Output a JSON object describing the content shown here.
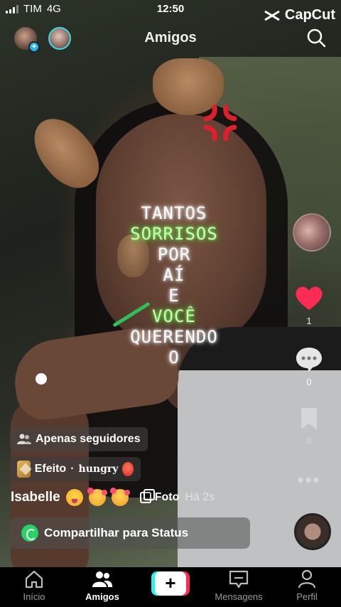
{
  "status_bar": {
    "carrier": "TIM",
    "network": "4G",
    "time": "12:50",
    "watermark": "CapCut"
  },
  "header": {
    "title": "Amigos"
  },
  "overlay": {
    "lines": [
      "TANTOS",
      "SORRISOS",
      "POR",
      "AÍ",
      "E",
      "VOCÊ",
      "QUERENDO",
      "O"
    ]
  },
  "rail": {
    "likes": "1",
    "comments": "0",
    "saves": "0"
  },
  "post": {
    "audience": "Apenas seguidores",
    "effect_label": "Efeito",
    "effect_separator": "·",
    "effect_name": "hungry",
    "username": "Isabelle",
    "type_label": "Foto",
    "time_ago": "Há 2s",
    "share_label": "Compartilhar para Status"
  },
  "nav": {
    "home": "Início",
    "friends": "Amigos",
    "messages": "Mensagens",
    "profile": "Perfil"
  },
  "colors": {
    "like": "#fe2c55",
    "accent_cyan": "#25f4ee",
    "whatsapp": "#25d366"
  }
}
